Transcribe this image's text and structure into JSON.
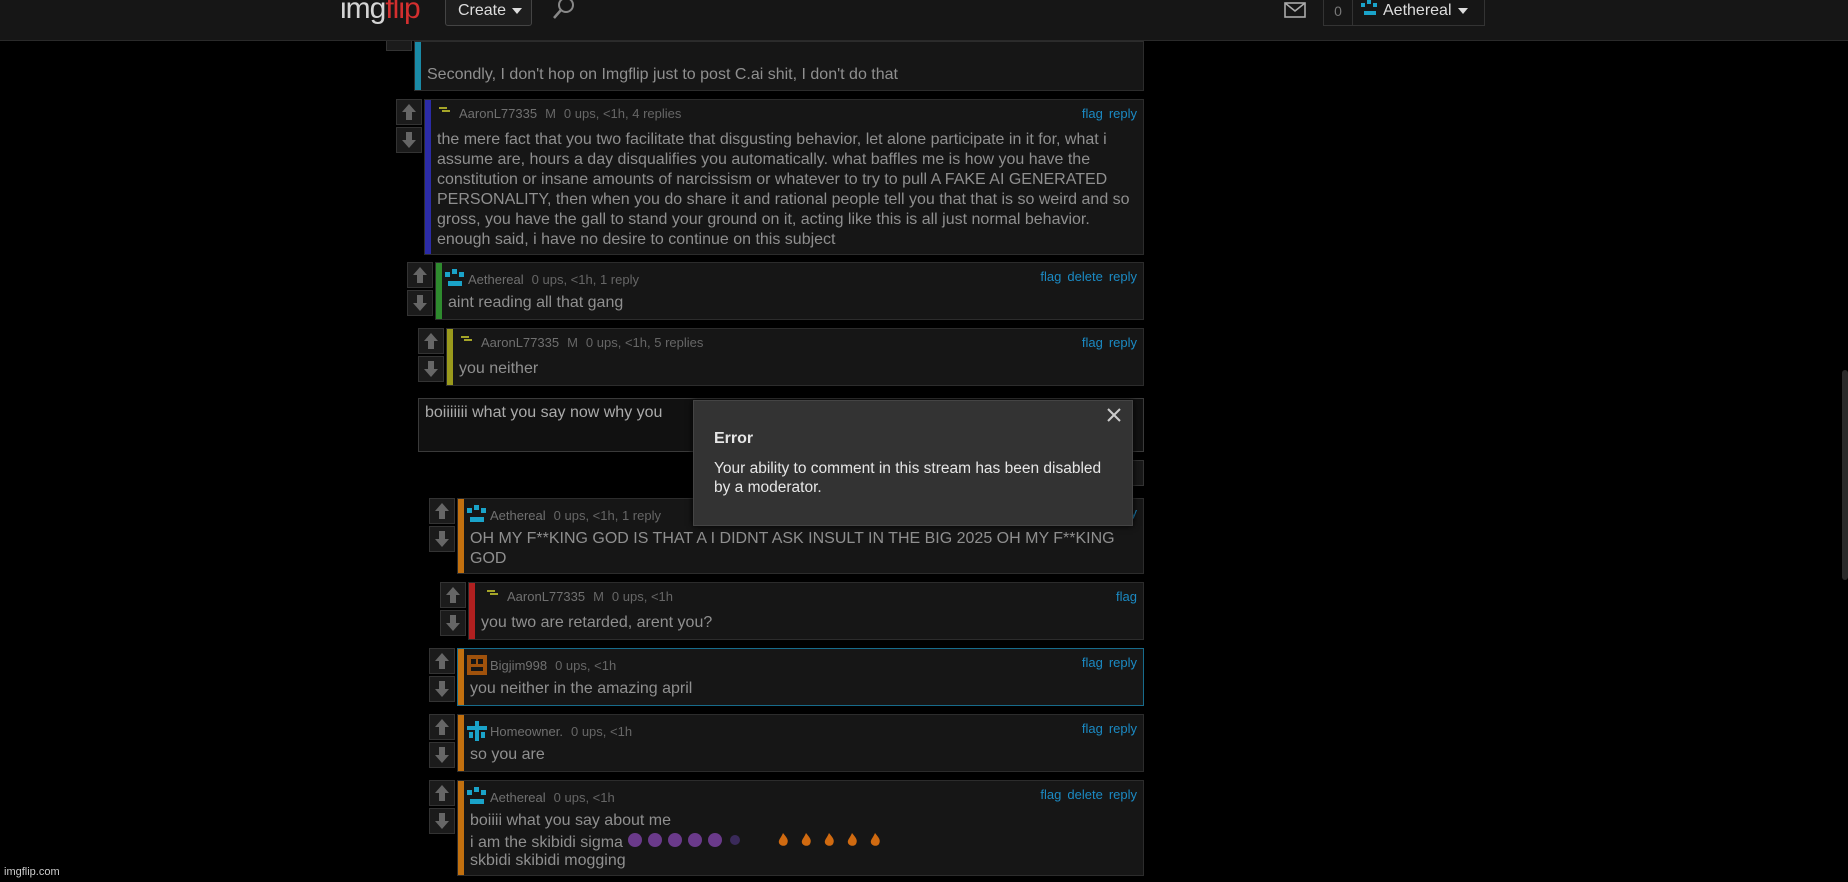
{
  "header": {
    "logo_part1": "img",
    "logo_part2": "flip",
    "create_label": "Create",
    "notifications_count": "0",
    "username": "Aethereal"
  },
  "comments": [
    {
      "username": "",
      "meta": "",
      "text_line1": "Secondly, I don't hop on Imgflip just to post C.ai shit, I don't do that",
      "bar_color": "#1a8aa6"
    },
    {
      "username": "AaronL77335",
      "badge": "M",
      "meta": "0 ups, <1h, 4 replies",
      "actions": [
        "flag",
        "reply"
      ],
      "text": "the mere fact that you two facilitate that disgusting behavior, let alone participate in it for, what i assume are, hours a day disqualifies you automatically. what baffles me is how you have the constitution or insane amounts of narcissism or whatever to try to pull A FAKE AI GENERATED PERSONALITY, then when you do share it and rational people tell you that that is so weird and so gross, you have the gall to stand your ground on it, acting like this is all just normal behavior. enough said, i have no desire to continue on this subject",
      "bar_color": "#2b2ba6"
    },
    {
      "username": "Aethereal",
      "meta": "0 ups, <1h, 1 reply",
      "actions": [
        "flag",
        "delete",
        "reply"
      ],
      "text": "aint reading all that gang",
      "bar_color": "#2e8b2e"
    },
    {
      "username": "AaronL77335",
      "badge": "M",
      "meta": "0 ups, <1h, 5 replies",
      "actions": [
        "flag",
        "reply"
      ],
      "text": "you neither",
      "bar_color": "#9a9a1c"
    },
    {
      "username": "Aethereal",
      "meta": "0 ups, <1h, 1 reply",
      "actions": [
        "reply"
      ],
      "text": "OH MY F**KING GOD IS THAT A I DIDNT ASK INSULT IN THE BIG 2025 OH MY F**KING GOD",
      "bar_color": "#c2700f"
    },
    {
      "username": "AaronL77335",
      "badge": "M",
      "meta": "0 ups, <1h",
      "actions": [
        "flag"
      ],
      "text": "you two are retarded, arent you?",
      "bar_color": "#b02020"
    },
    {
      "username": "Bigjim998",
      "meta": "0 ups, <1h",
      "actions": [
        "flag",
        "reply"
      ],
      "text": "you neither in the amazing april",
      "bar_color": "#c2700f"
    },
    {
      "username": "Homeowner.",
      "meta": "0 ups, <1h",
      "actions": [
        "flag",
        "reply"
      ],
      "text": "so you are",
      "bar_color": "#c2700f"
    },
    {
      "username": "Aethereal",
      "meta": "0 ups, <1h",
      "actions": [
        "flag",
        "delete",
        "reply"
      ],
      "text_line1": "boiiii what you say about me",
      "text_line2": "i am the skibidi sigma",
      "text_line3": "skbidi skibidi mogging",
      "bar_color": "#c2700f"
    }
  ],
  "reply_box": {
    "value": "boiiiiiii what you say now why you"
  },
  "modal": {
    "title": "Error",
    "body": "Your ability to comment in this stream has been disabled by a moderator."
  },
  "footer": {
    "brand": "imgflip.com"
  },
  "colors": {
    "link": "#1b8ac3",
    "logo_red": "#d32f2f"
  }
}
